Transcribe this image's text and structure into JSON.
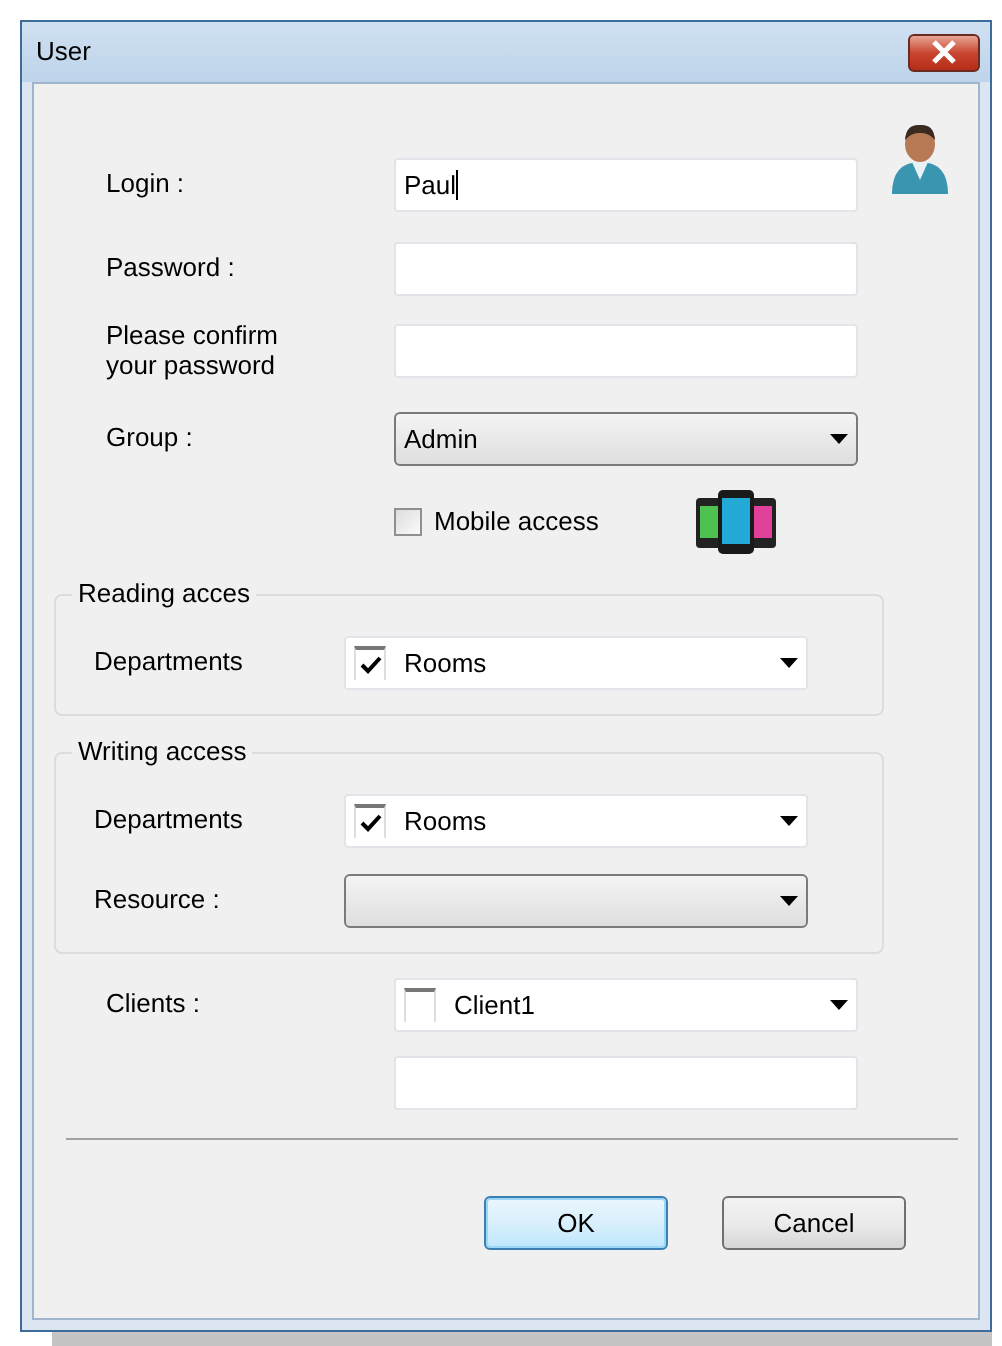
{
  "window": {
    "title": "User"
  },
  "fields": [
    {
      "kind": "text",
      "label": "Login :",
      "value": "Paul"
    },
    {
      "kind": "text",
      "label": "Password :"
    },
    {
      "kind": "text",
      "label": "Please confirm your password"
    },
    {
      "kind": "select",
      "label": "Group :",
      "value": "Admin"
    }
  ],
  "mobile_access": {
    "label": "Mobile access",
    "checked": false
  },
  "reading_access": {
    "title": "Reading acces",
    "fields": [
      {
        "kind": "check_combo",
        "label": "Departments",
        "value": "Rooms",
        "checked": true
      }
    ]
  },
  "writing_access": {
    "title": "Writing access",
    "fields": [
      {
        "kind": "check_combo",
        "label": "Departments",
        "value": "Rooms",
        "checked": true
      },
      {
        "kind": "select",
        "label": "Resource :"
      }
    ]
  },
  "client_fields": [
    {
      "kind": "check_combo",
      "label": "Clients :",
      "value": "Client1",
      "checked": false
    },
    {
      "kind": "text"
    }
  ],
  "buttons": [
    {
      "label": "OK",
      "selected": true
    },
    {
      "label": "Cancel",
      "selected": false
    }
  ]
}
